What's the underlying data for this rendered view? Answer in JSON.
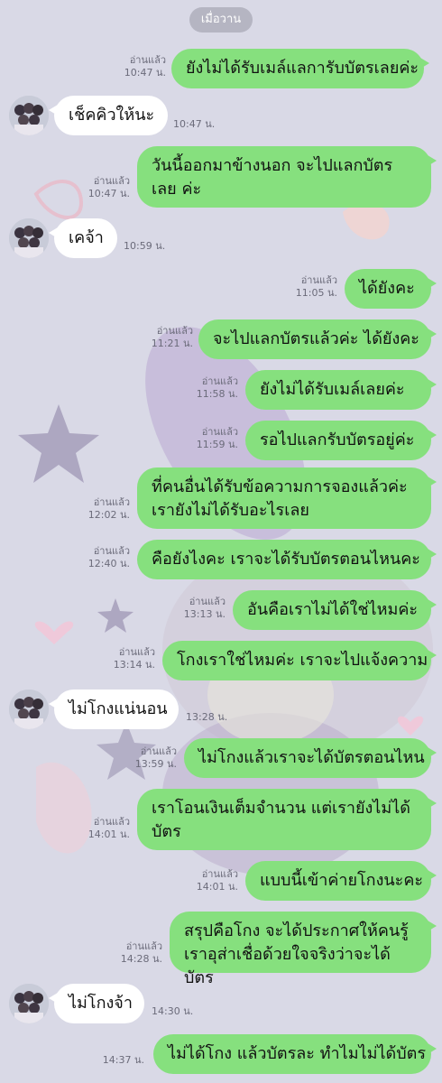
{
  "date_label": "เมื่อวาน",
  "read_label": "อ่านแล้ว",
  "messages": [
    {
      "dir": "out",
      "text": "ยังไม่ได้รับเมล์แลการับบัตรเลยค่ะ",
      "time": "10:47 น."
    },
    {
      "dir": "in",
      "text": "เช็คคิวให้นะ",
      "time": "10:47 น."
    },
    {
      "dir": "out",
      "text": "วันนี้ออกมาข้างนอก จะไปแลกบัตรเลย ค่ะ",
      "time": "10:47 น."
    },
    {
      "dir": "in",
      "text": "เคจ้า",
      "time": "10:59 น."
    },
    {
      "dir": "out",
      "text": "ได้ยังคะ",
      "time": "11:05 น."
    },
    {
      "dir": "out",
      "text": "จะไปแลกบัตรแล้วค่ะ ได้ยังคะ",
      "time": "11:21 น."
    },
    {
      "dir": "out",
      "text": "ยังไม่ได้รับเมล์เลยค่ะ",
      "time": "11:58 น."
    },
    {
      "dir": "out",
      "text": "รอไปแลกรับบัตรอยู่ค่ะ",
      "time": "11:59 น."
    },
    {
      "dir": "out",
      "text": "ที่คนอื่นได้รับข้อความการจองแล้วค่ะ เรายังไม่ได้รับอะไรเลย",
      "time": "12:02 น."
    },
    {
      "dir": "out",
      "text": "คือยังไงคะ เราจะได้รับบัตรตอนไหนคะ",
      "time": "12:40 น."
    },
    {
      "dir": "out",
      "text": "อันคือเราไม่ได้ใช่ไหมค่ะ",
      "time": "13:13 น."
    },
    {
      "dir": "out",
      "text": "โกงเราใช่ไหมค่ะ เราจะไปแจ้งความ",
      "time": "13:14 น."
    },
    {
      "dir": "in",
      "text": "ไม่โกงแน่นอน",
      "time": "13:28 น."
    },
    {
      "dir": "out",
      "text": "ไม่โกงแล้วเราจะได้บัตรตอนไหน",
      "time": "13:59 น."
    },
    {
      "dir": "out",
      "text": "เราโอนเงินเต็มจำนวน แต่เรายังไม่ได้ บัตร",
      "time": "14:01 น."
    },
    {
      "dir": "out",
      "text": "แบบนี้เข้าค่ายโกงนะคะ",
      "time": "14:01 น."
    },
    {
      "dir": "out",
      "text": "สรุปคือโกง จะได้ประกาศให้คนรู้ เราอุส่าเชื่อด้วยใจจริงว่าจะได้บัตร",
      "time": "14:28 น."
    },
    {
      "dir": "in",
      "text": "ไม่โกงจ้า",
      "time": "14:30 น."
    },
    {
      "dir": "out",
      "text": "ไม่ได้โกง แล้วบัตรละ ทำไมไม่ได้บัตร",
      "time": "14:37 น."
    }
  ],
  "colors": {
    "background": "#d9d9e6",
    "outgoing_bubble": "#86e07e",
    "incoming_bubble": "#ffffff",
    "meta_text": "#6b6b7a"
  },
  "icons": {
    "avatar": "group-photo-avatar-icon"
  }
}
